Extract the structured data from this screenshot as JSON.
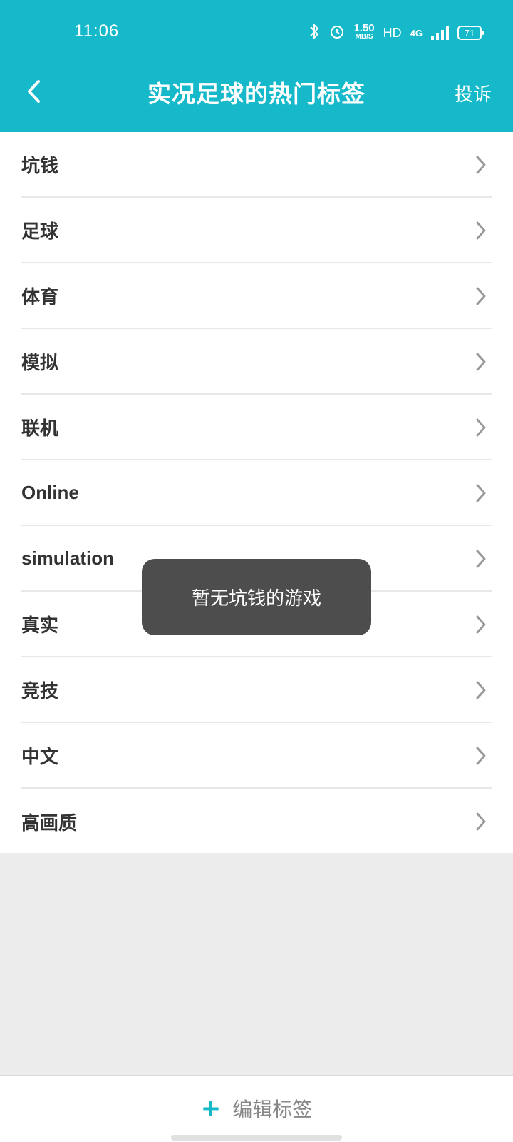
{
  "status_bar": {
    "time": "11:06",
    "speed_value": "1.50",
    "speed_unit": "MB/S",
    "hd": "HD",
    "network": "4G",
    "battery": "71"
  },
  "header": {
    "title": "实况足球的热门标签",
    "report_label": "投诉"
  },
  "tags": [
    {
      "label": "坑钱"
    },
    {
      "label": "足球"
    },
    {
      "label": "体育"
    },
    {
      "label": "模拟"
    },
    {
      "label": "联机"
    },
    {
      "label": "Online"
    },
    {
      "label": "simulation"
    },
    {
      "label": "真实"
    },
    {
      "label": "竞技"
    },
    {
      "label": "中文"
    },
    {
      "label": "高画质"
    }
  ],
  "toast": {
    "message": "暂无坑钱的游戏"
  },
  "bottom": {
    "edit_label": "编辑标签",
    "plus_icon": "plus-icon"
  },
  "colors": {
    "accent": "#15b9c9",
    "toast_bg": "#4d4d4d"
  }
}
